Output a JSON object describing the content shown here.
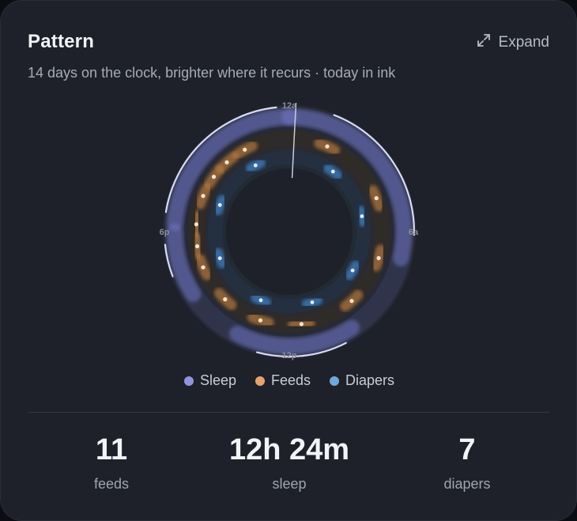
{
  "header": {
    "title": "Pattern",
    "subtitle": "14 days on the clock, brighter where it recurs · today in ink",
    "expand_label": "Expand"
  },
  "clock": {
    "labels": {
      "top": "12a",
      "right": "6a",
      "bottom": "12p",
      "left": "6p"
    },
    "now_hour": 0.2
  },
  "legend": [
    {
      "label": "Sleep",
      "color": "#8f94e0"
    },
    {
      "label": "Feeds",
      "color": "#e6a46a"
    },
    {
      "label": "Diapers",
      "color": "#6fa8dc"
    }
  ],
  "stats": [
    {
      "value": "11",
      "label": "feeds"
    },
    {
      "value": "12h 24m",
      "label": "sleep"
    },
    {
      "value": "7",
      "label": "diapers"
    }
  ],
  "pattern": {
    "sleep_history": [
      [
        18.3,
        24
      ],
      [
        0,
        6.9
      ],
      [
        9.8,
        13.8
      ],
      [
        15.8,
        18.0
      ]
    ],
    "sleep_today": [
      [
        18.6,
        23.6
      ],
      [
        1.4,
        6.1
      ],
      [
        10.2,
        13.0
      ],
      [
        16.6,
        17.6
      ]
    ],
    "feeds_hours": [
      1.6,
      4.6,
      7.1,
      9.2,
      11.5,
      13.2,
      14.9,
      16.5,
      17.4,
      18.3,
      19.5,
      20.4,
      21.2,
      22.1
    ],
    "diapers_hours": [
      2.4,
      5.2,
      8.1,
      10.8,
      13.5,
      16.6,
      19.4,
      22.2
    ]
  }
}
